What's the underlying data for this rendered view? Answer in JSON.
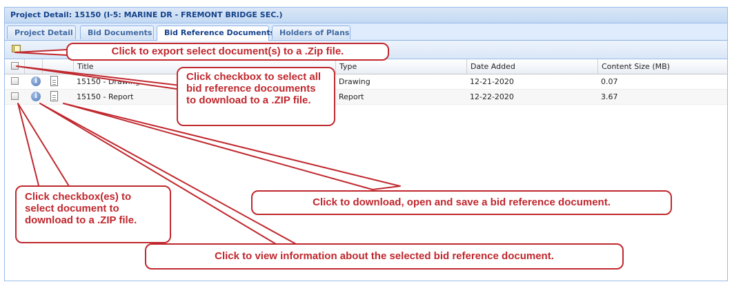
{
  "panel": {
    "title": "Project Detail: 15150 (I-5: MARINE DR - FREMONT BRIDGE SEC.)"
  },
  "tabs": [
    {
      "label": "Project Detail",
      "active": false
    },
    {
      "label": "Bid Documents",
      "active": false
    },
    {
      "label": "Bid Reference Documents",
      "active": true
    },
    {
      "label": "Holders of Plans",
      "active": false
    }
  ],
  "toolbar": {
    "export_icon": "zip-export-icon"
  },
  "grid": {
    "columns": [
      "Title",
      "Type",
      "Date Added",
      "Content Size (MB)"
    ],
    "rows": [
      {
        "title": "15150 - Drawing",
        "type": "Drawing",
        "date_added": "12-21-2020",
        "size": "0.07"
      },
      {
        "title": "15150 - Report",
        "type": "Report",
        "date_added": "12-22-2020",
        "size": "3.67"
      }
    ]
  },
  "callouts": {
    "export": "Click to export select document(s) to a .Zip file.",
    "select_all": "Click checkbox to select all bid reference docouments to download to a .ZIP file.",
    "select_doc": "Click checkbox(es) to select document to download to a .ZIP file.",
    "download": "Click to download, open and save a bid reference document.",
    "info": "Click to view information about the selected bid reference document."
  },
  "colors": {
    "callout_red": "#c0272d",
    "header_blue": "#15428b"
  }
}
